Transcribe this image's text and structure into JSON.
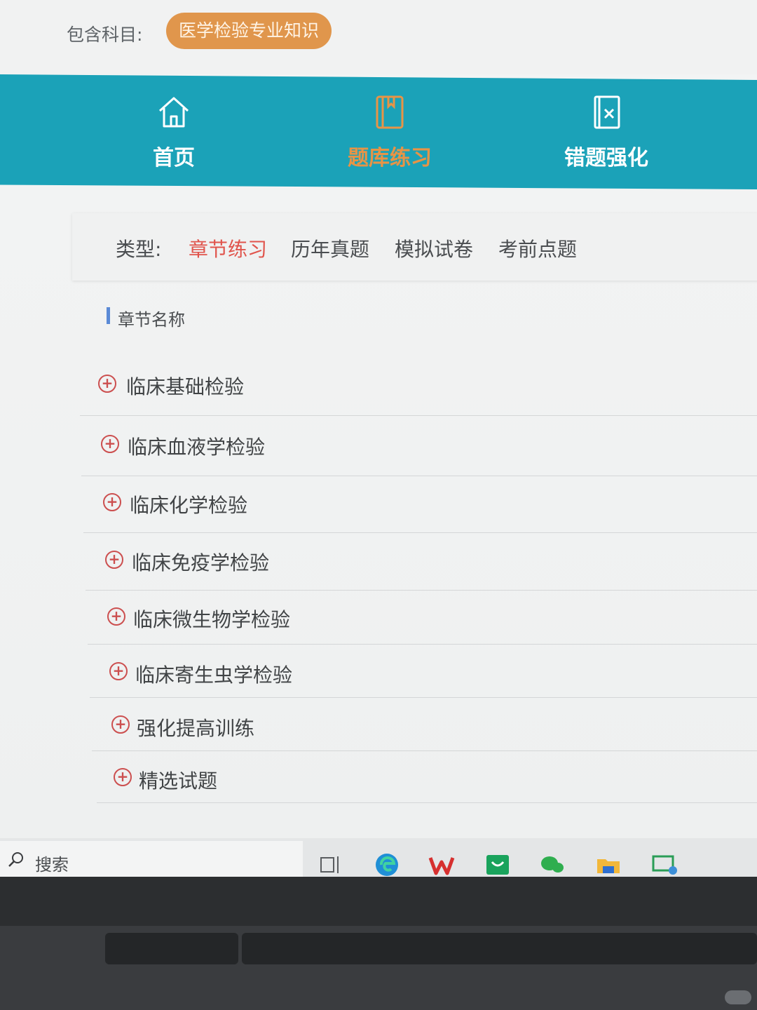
{
  "subject": {
    "label": "包含科目:",
    "chip": "医学检验专业知识"
  },
  "nav": {
    "items": [
      {
        "label": "首页",
        "icon": "home-icon"
      },
      {
        "label": "题库练习",
        "icon": "book-icon",
        "active": true
      },
      {
        "label": "错题强化",
        "icon": "wrong-question-icon"
      }
    ],
    "bg_color": "#1ba2b8",
    "active_color": "#e79446"
  },
  "type_filter": {
    "label": "类型:",
    "options": [
      "章节练习",
      "历年真题",
      "模拟试卷",
      "考前点题"
    ],
    "active": "章节练习",
    "active_color": "#e0544c"
  },
  "chapter": {
    "heading": "章节名称",
    "expand_icon": "plus-circle-icon",
    "items": [
      "临床基础检验",
      "临床血液学检验",
      "临床化学检验",
      "临床免疫学检验",
      "临床微生物学检验",
      "临床寄生虫学检验",
      "强化提高训练",
      "精选试题"
    ]
  },
  "taskbar": {
    "search_text": "搜索",
    "apps": [
      "task-view-icon",
      "edge-icon",
      "wps-icon",
      "store-icon",
      "wechat-icon",
      "file-explorer-icon",
      "remote-desktop-icon"
    ]
  }
}
